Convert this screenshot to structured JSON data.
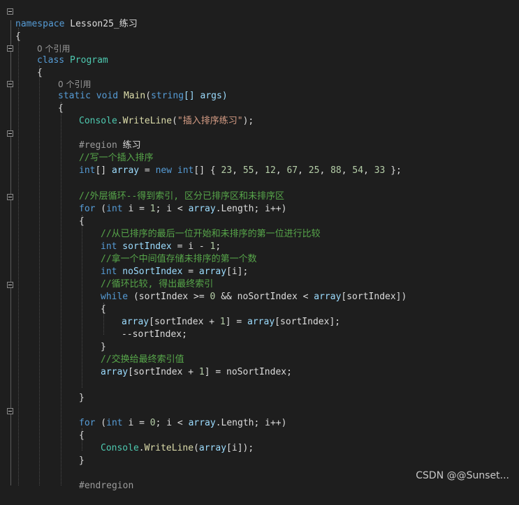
{
  "editor": {
    "codelens_class": "0 个引用",
    "codelens_main": "0 个引用",
    "lines": {
      "ns_kw": "namespace",
      "ns_name": " Lesson25_练习",
      "brace_open": "{",
      "class_kw": "class",
      "class_name": "Program",
      "class_brace": "{",
      "main_static": "static",
      "main_void": "void",
      "main_name": "Main",
      "main_paren_open": "(",
      "main_string": "string",
      "main_params": "[] args)",
      "main_brace": "{",
      "console1_type": "Console",
      "console1_dot": ".",
      "console1_fn": "WriteLine",
      "console1_open": "(",
      "console1_str": "\"插入排序练习\"",
      "console1_close": ");",
      "region_kw": "#region",
      "region_name": " 练习",
      "cm1": "//写一个插入排序",
      "arr_type": "int",
      "arr_brk": "[] ",
      "arr_var": "array",
      "arr_eq": " = ",
      "arr_new": "new",
      "arr_int": " int",
      "arr_vals_pre": "[] { ",
      "arr_values": [
        "23",
        "55",
        "12",
        "67",
        "25",
        "88",
        "54",
        "33"
      ],
      "arr_end": " };",
      "cm2": "//外层循环--得到索引, 区分已排序区和未排序区",
      "for1_kw": "for",
      "for1_rest_a": " (",
      "for1_int": "int",
      "for1_rest_b": " i = ",
      "for1_one": "1",
      "for1_rest_c": "; i < ",
      "for1_array": "array",
      "for1_rest_d": ".Length; i++)",
      "for1_brace": "{",
      "cm3": "//从已排序的最后一位开始和未排序的第一位进行比较",
      "si_int": "int",
      "si_var": " sortIndex",
      "si_rest": " = i - ",
      "si_one": "1",
      "si_end": ";",
      "cm4": "//拿一个中间值存储未排序的第一个数",
      "ns_int": "int",
      "ns_var": " noSortIndex",
      "ns_eq": " = ",
      "ns_arr": "array",
      "ns_rest": "[i];",
      "cm5": "//循环比较, 得出最终索引",
      "wh_kw": "while",
      "wh_a": " (sortIndex >= ",
      "wh_zero": "0",
      "wh_b": " && noSortIndex < ",
      "wh_arr": "array",
      "wh_c": "[sortIndex])",
      "wh_brace": "{",
      "as_arr": "array",
      "as_a": "[sortIndex + ",
      "as_one": "1",
      "as_b": "] = ",
      "as_arr2": "array",
      "as_c": "[sortIndex];",
      "dec": "--sortIndex;",
      "wh_close": "}",
      "cm6": "//交换给最终索引值",
      "fin_arr": "array",
      "fin_a": "[sortIndex + ",
      "fin_one": "1",
      "fin_b": "] = noSortIndex;",
      "for1_close": "}",
      "for2_kw": "for",
      "for2_a": " (",
      "for2_int": "int",
      "for2_b": " i = ",
      "for2_zero": "0",
      "for2_c": "; i < ",
      "for2_arr": "array",
      "for2_d": ".Length; i++)",
      "for2_brace": "{",
      "c2_type": "Console",
      "c2_dot": ".",
      "c2_fn": "WriteLine",
      "c2_open": "(",
      "c2_arr": "array",
      "c2_rest": "[i]);",
      "for2_close": "}",
      "endregion": "#endregion"
    }
  },
  "watermark": "CSDN @@Sunset..."
}
